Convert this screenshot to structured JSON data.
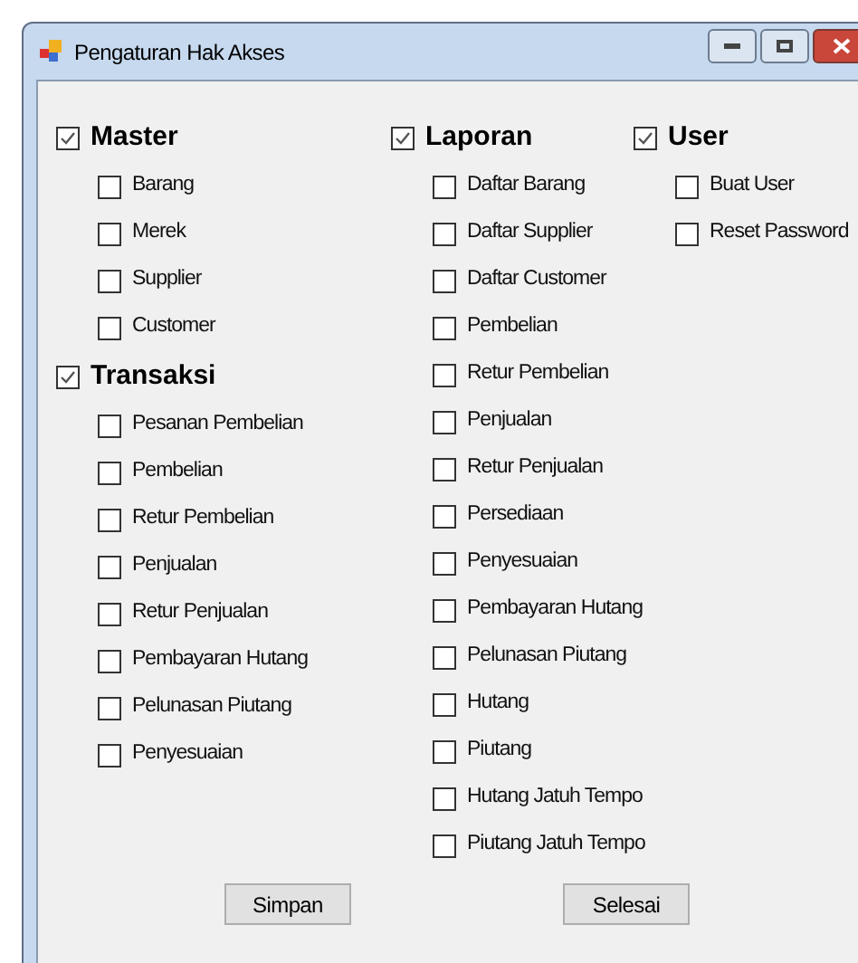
{
  "window": {
    "title": "Pengaturan Hak Akses"
  },
  "columns": [
    {
      "groups": [
        {
          "label": "Master",
          "checked": true,
          "items": [
            {
              "label": "Barang",
              "checked": false
            },
            {
              "label": "Merek",
              "checked": false
            },
            {
              "label": "Supplier",
              "checked": false
            },
            {
              "label": "Customer",
              "checked": false
            }
          ]
        },
        {
          "label": "Transaksi",
          "checked": true,
          "items": [
            {
              "label": "Pesanan Pembelian",
              "checked": false
            },
            {
              "label": "Pembelian",
              "checked": false
            },
            {
              "label": "Retur Pembelian",
              "checked": false
            },
            {
              "label": "Penjualan",
              "checked": false
            },
            {
              "label": "Retur Penjualan",
              "checked": false
            },
            {
              "label": "Pembayaran Hutang",
              "checked": false
            },
            {
              "label": "Pelunasan Piutang",
              "checked": false
            },
            {
              "label": "Penyesuaian",
              "checked": false
            }
          ]
        }
      ]
    },
    {
      "groups": [
        {
          "label": "Laporan",
          "checked": true,
          "items": [
            {
              "label": "Daftar Barang",
              "checked": false
            },
            {
              "label": "Daftar Supplier",
              "checked": false
            },
            {
              "label": "Daftar Customer",
              "checked": false
            },
            {
              "label": "Pembelian",
              "checked": false
            },
            {
              "label": "Retur Pembelian",
              "checked": false
            },
            {
              "label": "Penjualan",
              "checked": false
            },
            {
              "label": "Retur Penjualan",
              "checked": false
            },
            {
              "label": "Persediaan",
              "checked": false
            },
            {
              "label": "Penyesuaian",
              "checked": false
            },
            {
              "label": "Pembayaran Hutang",
              "checked": false
            },
            {
              "label": "Pelunasan Piutang",
              "checked": false
            },
            {
              "label": "Hutang",
              "checked": false
            },
            {
              "label": "Piutang",
              "checked": false
            },
            {
              "label": "Hutang Jatuh Tempo",
              "checked": false
            },
            {
              "label": "Piutang Jatuh Tempo",
              "checked": false
            }
          ]
        }
      ]
    },
    {
      "groups": [
        {
          "label": "User",
          "checked": true,
          "items": [
            {
              "label": "Buat User",
              "checked": false
            },
            {
              "label": "Reset Password",
              "checked": false
            }
          ]
        }
      ]
    }
  ],
  "buttons": [
    "Simpan",
    "Selesai"
  ]
}
